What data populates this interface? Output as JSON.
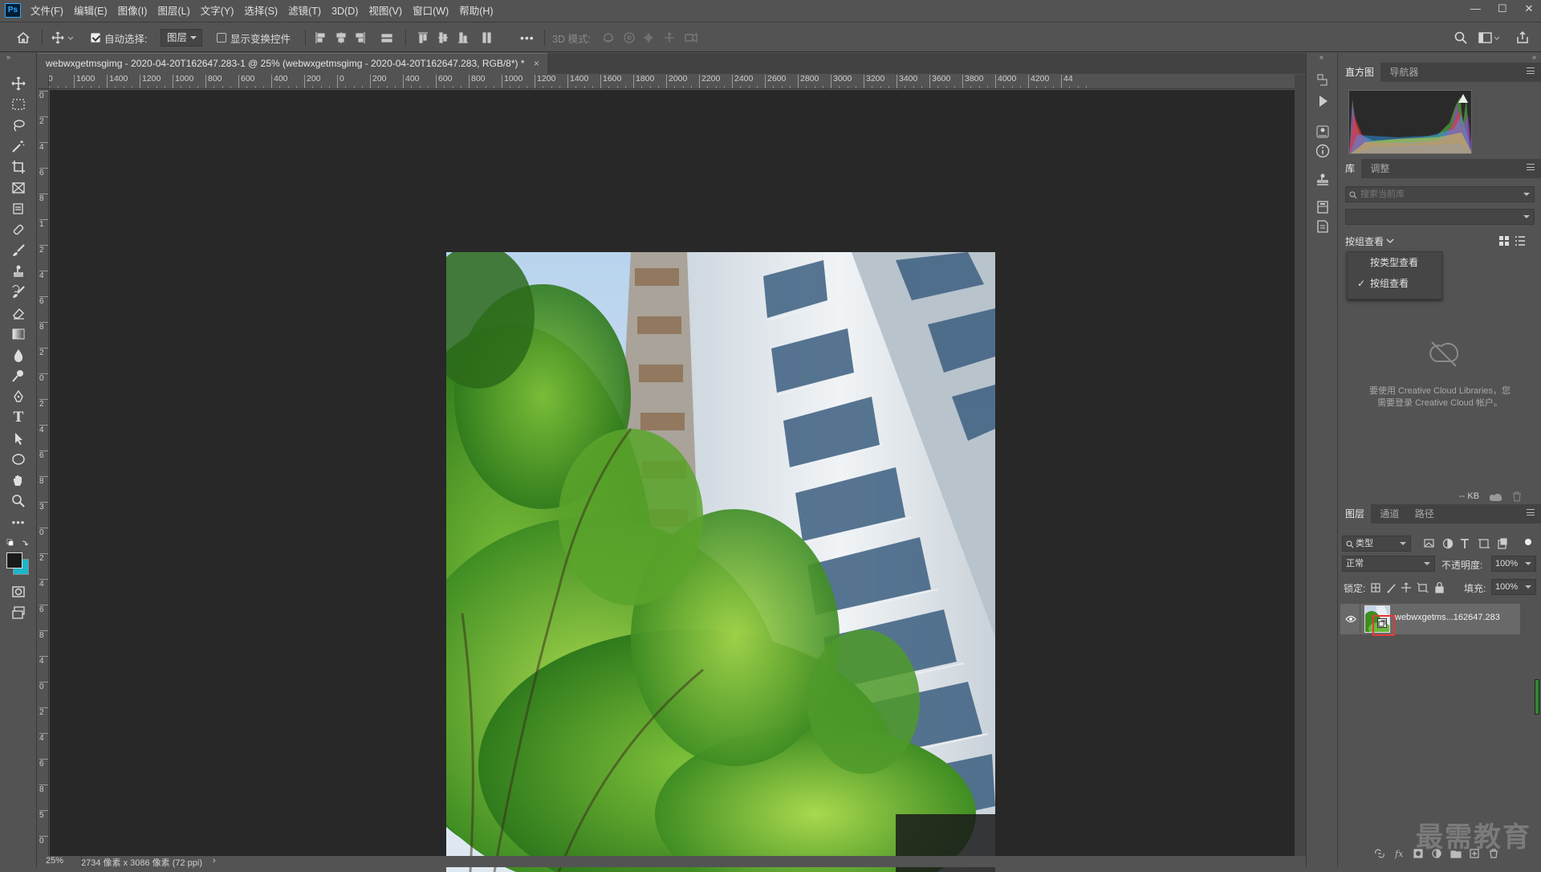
{
  "app": {
    "logo": "Ps"
  },
  "menu": [
    "文件(F)",
    "编辑(E)",
    "图像(I)",
    "图层(L)",
    "文字(Y)",
    "选择(S)",
    "滤镜(T)",
    "3D(D)",
    "视图(V)",
    "窗口(W)",
    "帮助(H)"
  ],
  "options": {
    "auto_select_label": "自动选择:",
    "auto_select_target": "图层",
    "show_transform_label": "显示变换控件",
    "mode_3d_label": "3D 模式:",
    "more": "•••"
  },
  "document": {
    "tab_title": "webwxgetmsgimg - 2020-04-20T162647.283-1 @ 25% (webwxgetmsgimg - 2020-04-20T162647.283, RGB/8*) *",
    "close": "×"
  },
  "ruler_top_labels": [
    "00",
    "1600",
    "1400",
    "1200",
    "1000",
    "800",
    "600",
    "400",
    "200",
    "0",
    "200",
    "400",
    "600",
    "800",
    "1000",
    "1200",
    "1400",
    "1600",
    "1800",
    "2000",
    "2200",
    "2400",
    "2600",
    "2800",
    "3000",
    "3200",
    "3400",
    "3600",
    "3800",
    "4000",
    "4200",
    "44"
  ],
  "ruler_left_labels": [
    "0",
    "2",
    "4",
    "6",
    "8",
    "1",
    "2",
    "4",
    "6",
    "8",
    "2",
    "0",
    "2",
    "4",
    "6",
    "8",
    "3",
    "0",
    "2",
    "4",
    "6",
    "8",
    "4",
    "0",
    "2",
    "4",
    "6",
    "8",
    "5",
    "0"
  ],
  "status": {
    "zoom": "25%",
    "dimensions": "2734 像素 x 3086 像素 (72 ppi)",
    "arrow": "›"
  },
  "panels": {
    "histogram_tabs": [
      "直方图",
      "导航器"
    ],
    "library_tabs": [
      "库",
      "调整"
    ],
    "library_search_placeholder": "搜索当前库",
    "view_by_group": "按组查看",
    "view_menu": [
      "按类型查看",
      "按组查看"
    ],
    "cc_message_line1": "要使用 Creative Cloud Libraries，您",
    "cc_message_line2": "需要登录 Creative Cloud 帐户。",
    "size_label": "-- KB",
    "layers_tabs": [
      "图层",
      "通道",
      "路径"
    ],
    "filter_kind": "类型",
    "blend_mode": "正常",
    "opacity_label": "不透明度:",
    "opacity_value": "100%",
    "lock_label": "锁定:",
    "fill_label": "填充:",
    "fill_value": "100%",
    "layer_name": "webwxgetms...162647.283"
  },
  "watermark": "最需教育",
  "colors": {
    "ui_bg": "#535353",
    "canvas_bg": "#282828",
    "highlight_red": "#e53935",
    "bg_swatch": "#1fb5c8",
    "fg_swatch": "#1a1a1a"
  }
}
